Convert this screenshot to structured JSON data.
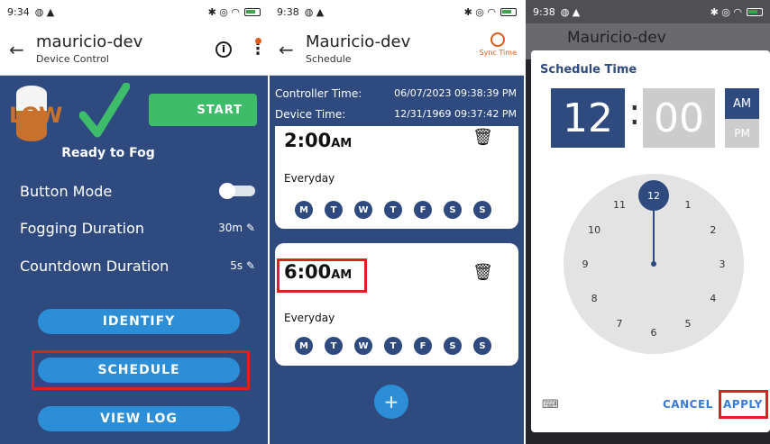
{
  "panel1": {
    "status": {
      "time": "9:34"
    },
    "appbar": {
      "title": "mauricio-dev",
      "subtitle": "Device Control"
    },
    "tank_label": "LOW",
    "start_label": "START",
    "ready_label": "Ready to Fog",
    "settings": [
      {
        "label": "Button Mode",
        "value": ""
      },
      {
        "label": "Fogging Duration",
        "value": "30m"
      },
      {
        "label": "Countdown Duration",
        "value": "5s"
      }
    ],
    "buttons": {
      "identify": "IDENTIFY",
      "schedule": "SCHEDULE",
      "view_log": "VIEW LOG"
    }
  },
  "panel2": {
    "status": {
      "time": "9:38"
    },
    "appbar": {
      "title": "Mauricio-dev",
      "subtitle": "Schedule",
      "sync_label": "Sync Time"
    },
    "controller_time": {
      "label": "Controller Time:",
      "value": "06/07/2023 09:38:39 PM"
    },
    "device_time": {
      "label": "Device Time:",
      "value": "12/31/1969 09:37:42 PM"
    },
    "schedules": [
      {
        "time": "2:00",
        "ampm": "AM",
        "repeat": "Everyday",
        "days": [
          "M",
          "T",
          "W",
          "T",
          "F",
          "S",
          "S"
        ]
      },
      {
        "time": "6:00",
        "ampm": "AM",
        "repeat": "Everyday",
        "days": [
          "M",
          "T",
          "W",
          "T",
          "F",
          "S",
          "S"
        ]
      }
    ],
    "fab_label": "+"
  },
  "panel3": {
    "status": {
      "time": "9:38"
    },
    "bg_title": "Mauricio-dev",
    "dialog": {
      "title": "Schedule Time",
      "hour": "12",
      "colon": ":",
      "minute": "00",
      "am": "AM",
      "pm": "PM",
      "clock_numbers": [
        "12",
        "1",
        "2",
        "3",
        "4",
        "5",
        "6",
        "7",
        "8",
        "9",
        "10",
        "11"
      ],
      "cancel": "CANCEL",
      "apply": "APPLY"
    }
  },
  "colors": {
    "navy": "#2e4a7e",
    "blue": "#2c8ed6",
    "green": "#3dbd6a",
    "highlight": "#e02020",
    "accent_orange": "#e05a1a"
  },
  "icons": {
    "back": "arrow-left-icon",
    "info": "info-icon",
    "menu": "more-vert-icon",
    "edit": "pencil-icon",
    "delete": "trash-icon",
    "sync": "clock-icon",
    "keyboard": "keyboard-icon"
  }
}
